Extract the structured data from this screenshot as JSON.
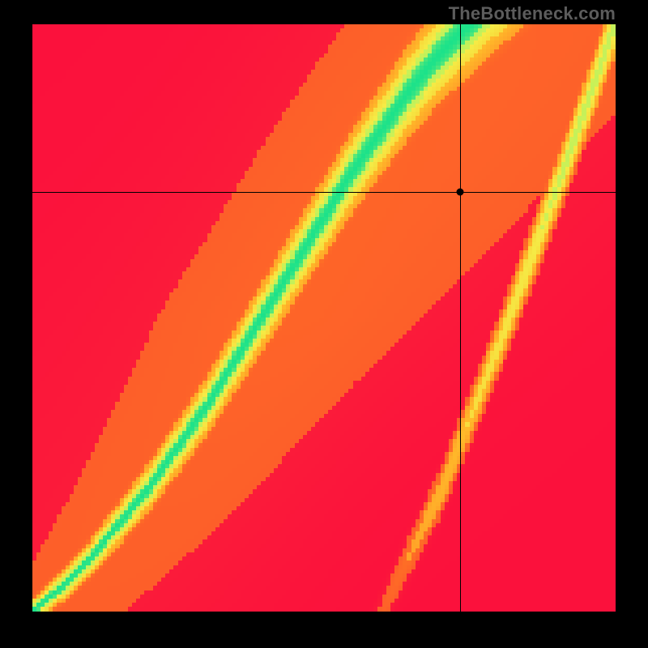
{
  "watermark": "TheBottleneck.com",
  "chart_data": {
    "type": "heatmap",
    "title": "",
    "xlabel": "",
    "ylabel": "",
    "xlim": [
      0,
      1
    ],
    "ylim": [
      0,
      1
    ],
    "marker": {
      "x": 0.734,
      "y": 0.715
    },
    "crosshair": {
      "x": 0.734,
      "y": 0.715
    },
    "ridge": [
      {
        "x": 0.0,
        "y": 0.0
      },
      {
        "x": 0.05,
        "y": 0.04
      },
      {
        "x": 0.1,
        "y": 0.09
      },
      {
        "x": 0.15,
        "y": 0.15
      },
      {
        "x": 0.2,
        "y": 0.21
      },
      {
        "x": 0.25,
        "y": 0.28
      },
      {
        "x": 0.3,
        "y": 0.35
      },
      {
        "x": 0.35,
        "y": 0.43
      },
      {
        "x": 0.4,
        "y": 0.51
      },
      {
        "x": 0.45,
        "y": 0.59
      },
      {
        "x": 0.5,
        "y": 0.67
      },
      {
        "x": 0.55,
        "y": 0.75
      },
      {
        "x": 0.6,
        "y": 0.82
      },
      {
        "x": 0.65,
        "y": 0.89
      },
      {
        "x": 0.7,
        "y": 0.95
      },
      {
        "x": 0.75,
        "y": 1.0
      }
    ],
    "second_ridge": [
      {
        "x": 0.6,
        "y": 0.0
      },
      {
        "x": 0.7,
        "y": 0.2
      },
      {
        "x": 0.8,
        "y": 0.45
      },
      {
        "x": 0.9,
        "y": 0.72
      },
      {
        "x": 1.0,
        "y": 1.0
      }
    ],
    "colorscale": [
      {
        "t": 0.0,
        "color": "#fb113c"
      },
      {
        "t": 0.35,
        "color": "#fe7225"
      },
      {
        "t": 0.6,
        "color": "#ffbf2a"
      },
      {
        "t": 0.8,
        "color": "#f4ed47"
      },
      {
        "t": 0.93,
        "color": "#b9f25e"
      },
      {
        "t": 1.0,
        "color": "#1ce28a"
      }
    ],
    "grid_resolution": 140
  }
}
